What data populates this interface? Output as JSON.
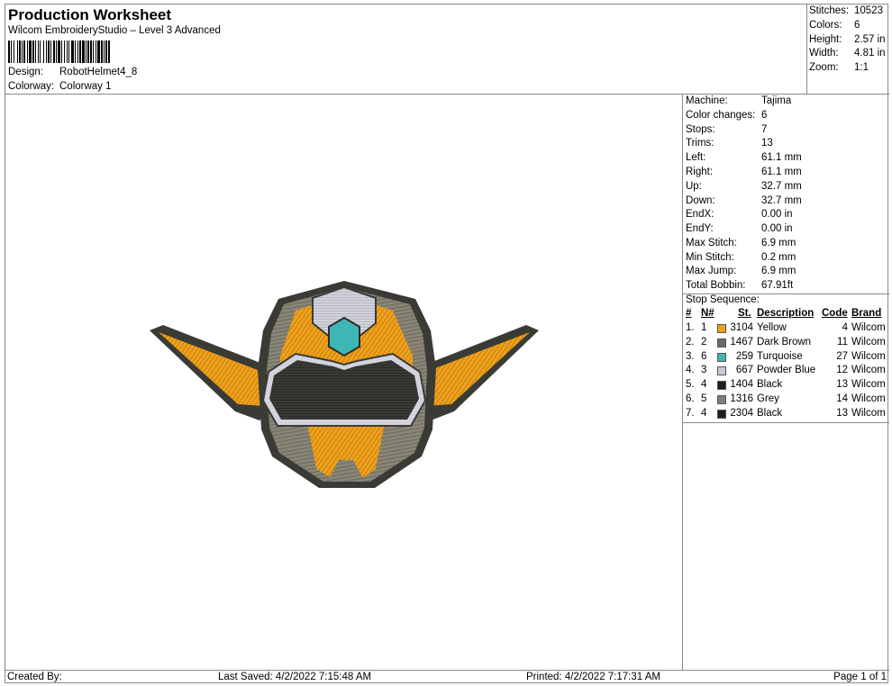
{
  "header": {
    "title": "Production Worksheet",
    "subtitle": "Wilcom EmbroideryStudio – Level 3 Advanced",
    "design_label": "Design:",
    "design_value": "RobotHelmet4_8",
    "colorway_label": "Colorway:",
    "colorway_value": "Colorway 1"
  },
  "stats": [
    {
      "label": "Stitches:",
      "value": "10523"
    },
    {
      "label": "Colors:",
      "value": "6"
    },
    {
      "label": "Height:",
      "value": "2.57 in"
    },
    {
      "label": "Width:",
      "value": "4.81 in"
    },
    {
      "label": "Zoom:",
      "value": "1:1"
    }
  ],
  "machine": [
    {
      "label": "Machine:",
      "value": "Tajima"
    },
    {
      "label": "Color changes:",
      "value": "6"
    },
    {
      "label": "Stops:",
      "value": "7"
    },
    {
      "label": "Trims:",
      "value": "13"
    },
    {
      "label": "Left:",
      "value": "61.1 mm"
    },
    {
      "label": "Right:",
      "value": "61.1 mm"
    },
    {
      "label": "Up:",
      "value": "32.7 mm"
    },
    {
      "label": "Down:",
      "value": "32.7 mm"
    },
    {
      "label": "EndX:",
      "value": "0.00 in"
    },
    {
      "label": "EndY:",
      "value": "0.00 in"
    },
    {
      "label": "Max Stitch:",
      "value": "6.9 mm"
    },
    {
      "label": "Min Stitch:",
      "value": "0.2 mm"
    },
    {
      "label": "Max Jump:",
      "value": "6.9 mm"
    },
    {
      "label": "Total Bobbin:",
      "value": "67.91ft"
    }
  ],
  "stop_sequence": {
    "title": "Stop Sequence:",
    "columns": {
      "idx": "#",
      "n": "N#",
      "st": "St.",
      "desc": "Description",
      "code": "Code",
      "brand": "Brand"
    },
    "rows": [
      {
        "idx": "1.",
        "n": "1",
        "color": "#f0a21c",
        "st": "3104",
        "desc": "Yellow",
        "code": "4",
        "brand": "Wilcom"
      },
      {
        "idx": "2.",
        "n": "2",
        "color": "#6e6a62",
        "st": "1467",
        "desc": "Dark Brown",
        "code": "11",
        "brand": "Wilcom"
      },
      {
        "idx": "3.",
        "n": "6",
        "color": "#3fb6b6",
        "st": "259",
        "desc": "Turquoise",
        "code": "27",
        "brand": "Wilcom"
      },
      {
        "idx": "4.",
        "n": "3",
        "color": "#c9c9d6",
        "st": "667",
        "desc": "Powder Blue",
        "code": "12",
        "brand": "Wilcom"
      },
      {
        "idx": "5.",
        "n": "4",
        "color": "#1e1e1e",
        "st": "1404",
        "desc": "Black",
        "code": "13",
        "brand": "Wilcom"
      },
      {
        "idx": "6.",
        "n": "5",
        "color": "#7d7d7d",
        "st": "1316",
        "desc": "Grey",
        "code": "14",
        "brand": "Wilcom"
      },
      {
        "idx": "7.",
        "n": "4",
        "color": "#1e1e1e",
        "st": "2304",
        "desc": "Black",
        "code": "13",
        "brand": "Wilcom"
      }
    ]
  },
  "footer": {
    "created_by": "Created By:",
    "last_saved": "Last Saved: 4/2/2022 7:15:48 AM",
    "printed": "Printed: 4/2/2022 7:17:31 AM",
    "page": "Page 1 of 1"
  }
}
